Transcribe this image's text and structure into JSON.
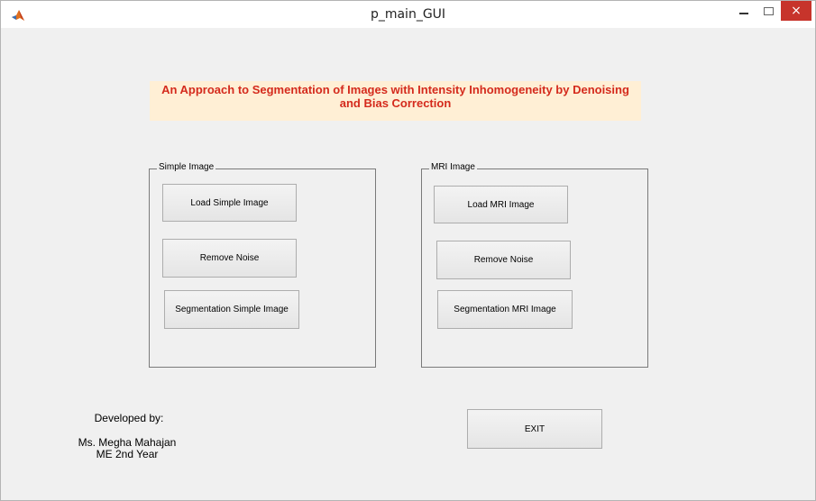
{
  "window": {
    "title": "p_main_GUI",
    "close_glyph": "×"
  },
  "heading": {
    "line1": "An Approach to Segmentation of Images with Intensity Inhomogeneity by Denoising",
    "line2": "and Bias Correction",
    "text_color": "#d42a1c",
    "background": "#ffefd5"
  },
  "simple_panel": {
    "title": "Simple Image",
    "buttons": [
      "Load Simple Image",
      "Remove Noise",
      "Segmentation Simple Image"
    ]
  },
  "mri_panel": {
    "title": "MRI Image",
    "buttons": [
      "Load MRI Image",
      "Remove Noise",
      "Segmentation MRI Image"
    ]
  },
  "credits": {
    "developed_by": "Developed by:",
    "name": "Ms. Megha Mahajan",
    "year": "ME 2nd Year"
  },
  "exit_label": "EXIT",
  "icons": {
    "app": "matlab-icon",
    "minimize": "minimize-icon",
    "maximize": "maximize-icon",
    "close": "close-icon"
  }
}
